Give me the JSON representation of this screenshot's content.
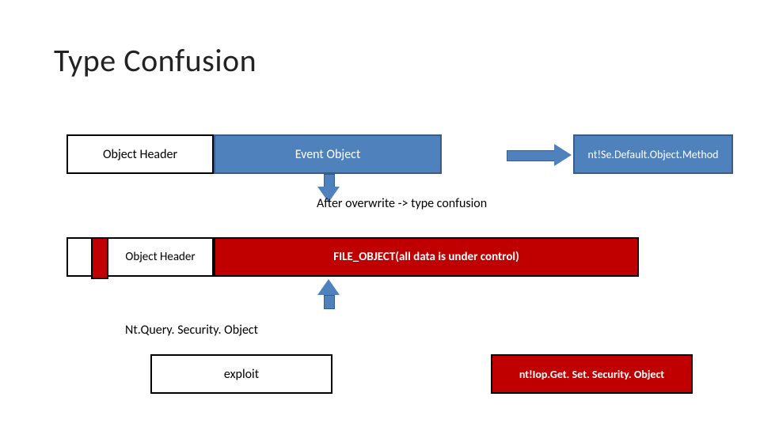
{
  "title": "Type Confusion",
  "row1": {
    "obj_header": "Object Header",
    "event_object": "Event Object",
    "target": "nt!Se.Default.Object.Method"
  },
  "mid_label": "After overwrite -> type confusion",
  "row2": {
    "obj_header": "Object Header",
    "file_object": "FILE_OBJECT(all data is under control)"
  },
  "labels": {
    "query": "Nt.Query. Security. Object",
    "exploit": "exploit",
    "iop": "nt!Iop.Get. Set. Security. Object"
  },
  "colors": {
    "blue": "#4f81bd",
    "blue_border": "#385d8a",
    "red": "#c00000"
  }
}
